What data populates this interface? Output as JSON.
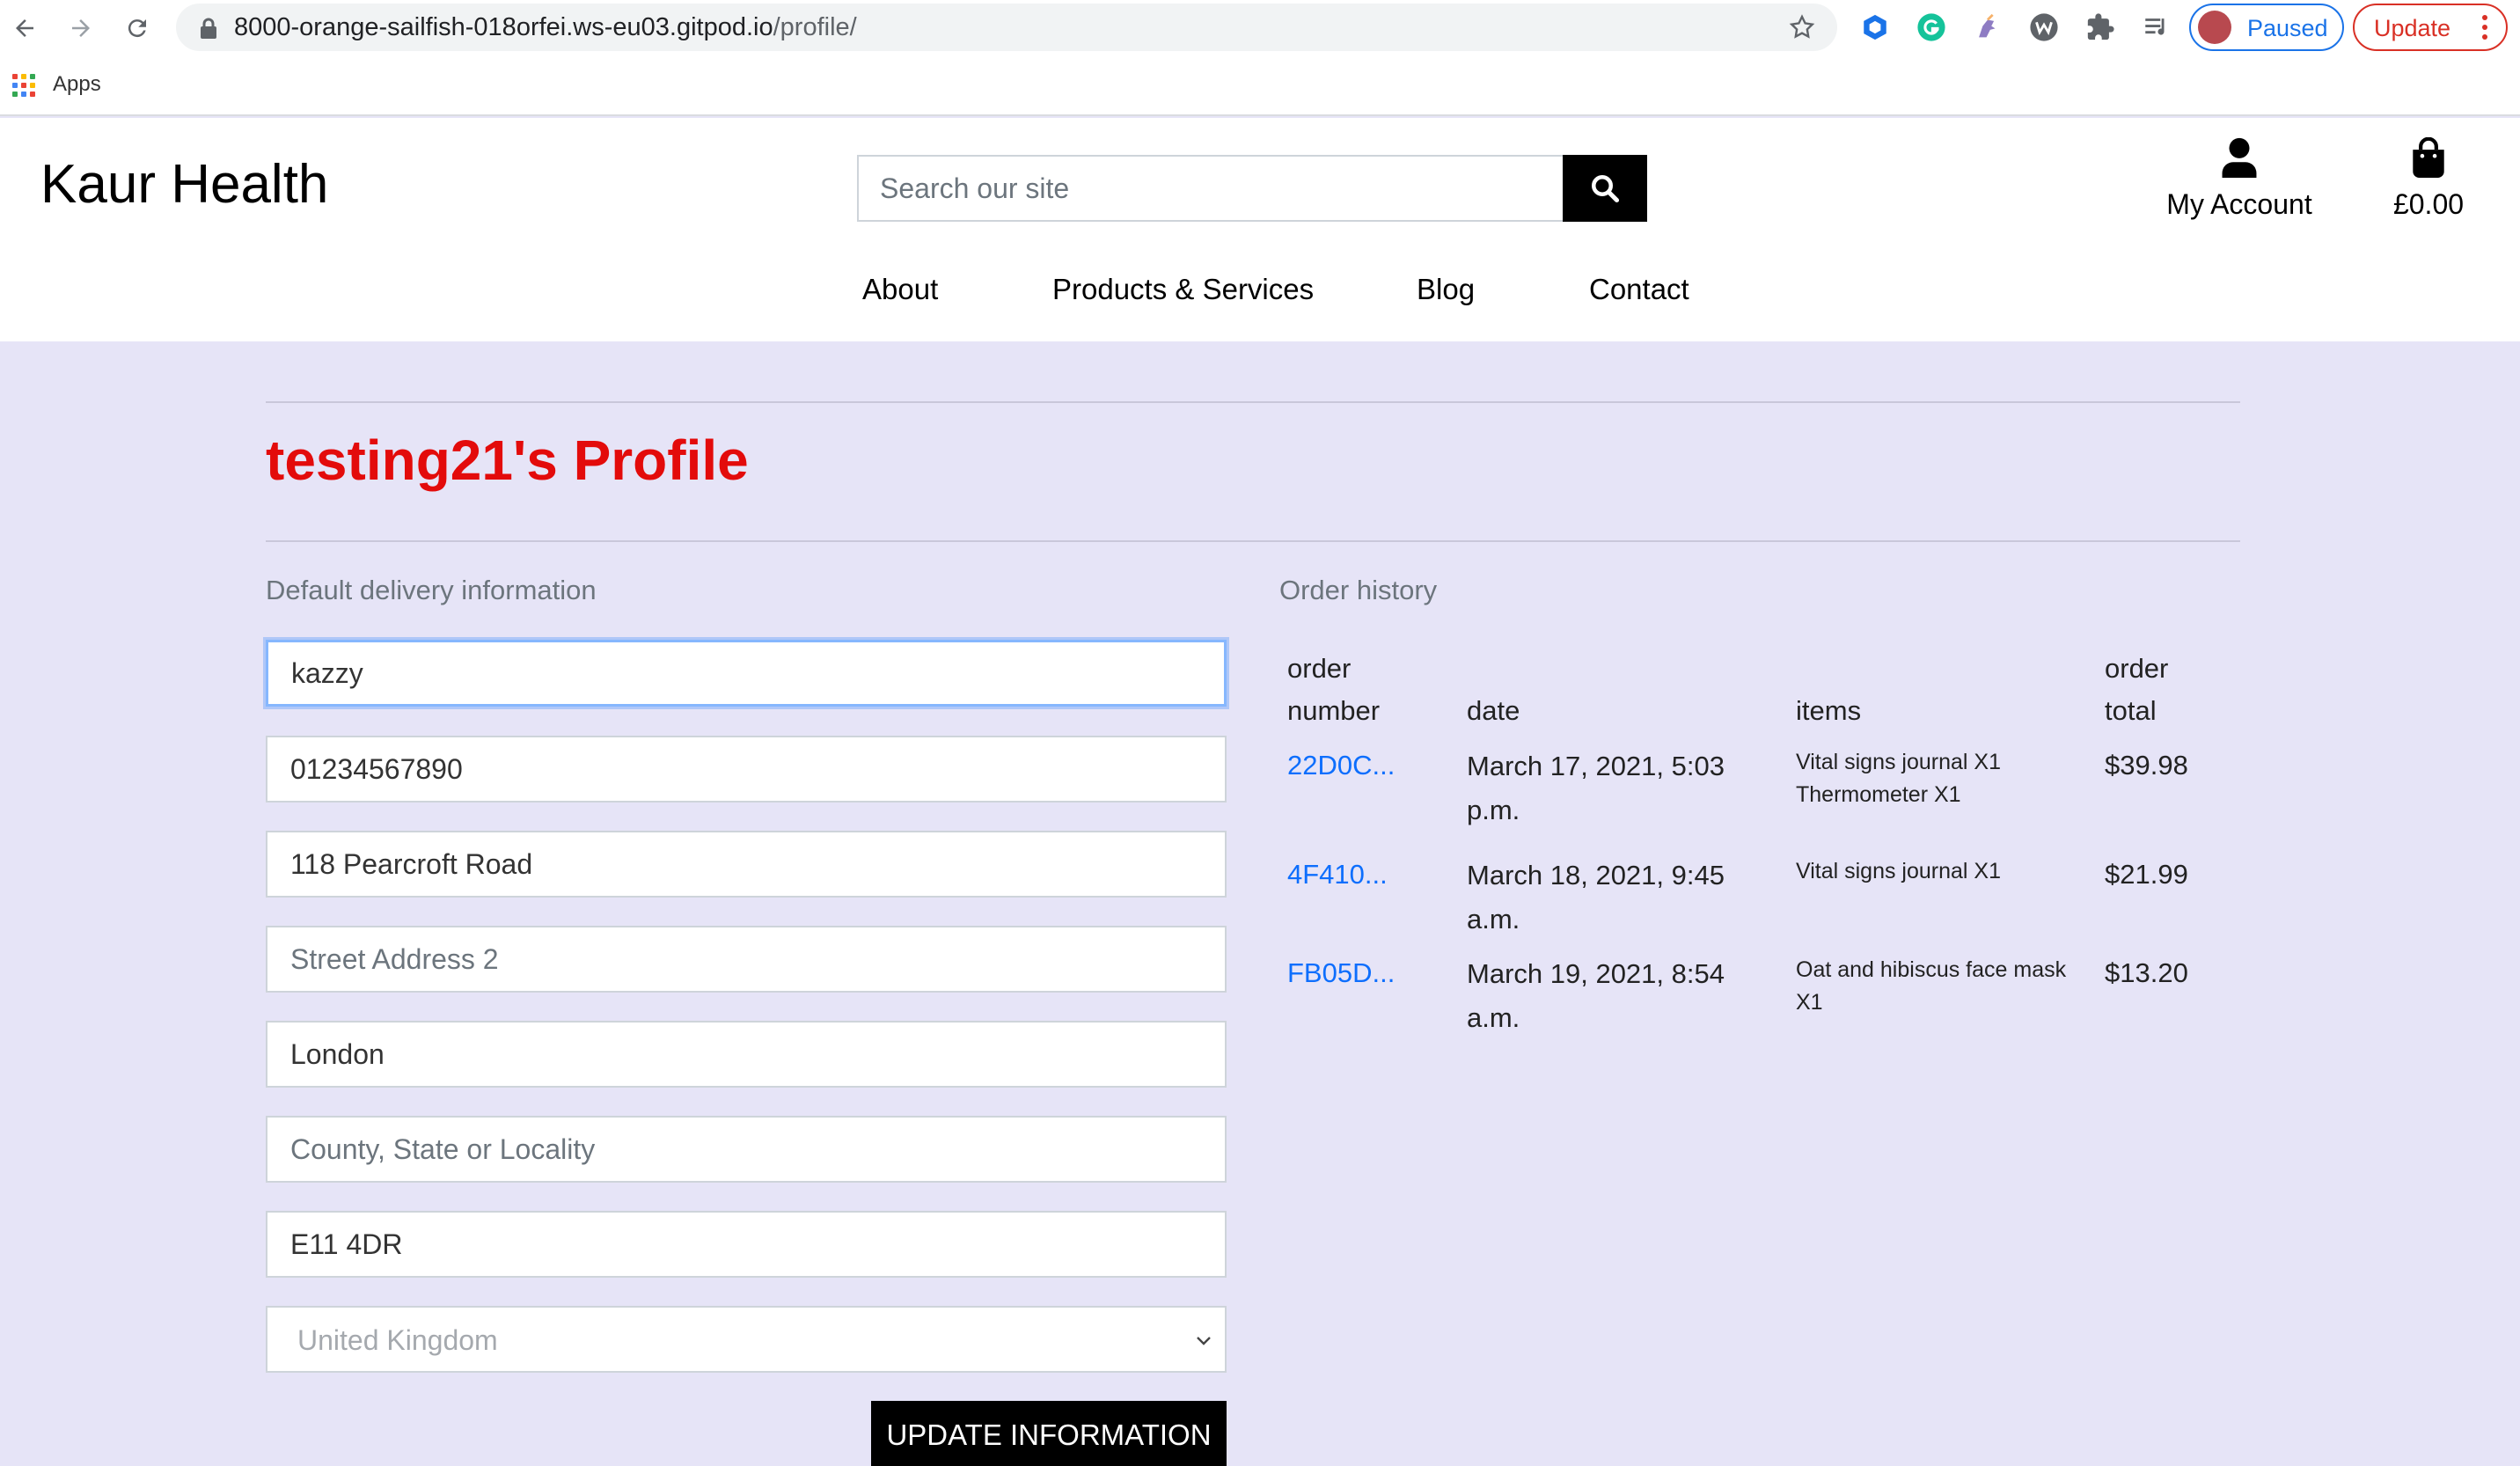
{
  "browser": {
    "url_host": "8000-orange-sailfish-018orfei.ws-eu03.gitpod.io",
    "url_path": "/profile/",
    "bookmarks": {
      "apps_label": "Apps"
    },
    "profile_status": "Paused",
    "update_label": "Update",
    "accent": "#1a73e8",
    "update_color": "#d93025"
  },
  "header": {
    "brand": "Kaur Health",
    "search_placeholder": "Search our site",
    "account_label": "My Account",
    "cart_total": "£0.00",
    "nav": [
      "About",
      "Products & Services",
      "Blog",
      "Contact"
    ]
  },
  "profile": {
    "title": "testing21's Profile",
    "title_color": "#e30b0b"
  },
  "delivery": {
    "heading": "Default delivery information",
    "fields": {
      "full_name": {
        "value": "kazzy",
        "placeholder": ""
      },
      "phone": {
        "value": "01234567890",
        "placeholder": ""
      },
      "street1": {
        "value": "118 Pearcroft Road",
        "placeholder": ""
      },
      "street2": {
        "value": "",
        "placeholder": "Street Address 2"
      },
      "town": {
        "value": "London",
        "placeholder": ""
      },
      "county": {
        "value": "",
        "placeholder": "County, State or Locality"
      },
      "postcode": {
        "value": "E11 4DR",
        "placeholder": ""
      },
      "country": {
        "value": "United Kingdom"
      }
    },
    "submit_label": "UPDATE INFORMATION"
  },
  "orders": {
    "heading": "Order history",
    "columns": {
      "number_l1": "order",
      "number_l2": "number",
      "date": "date",
      "items": "items",
      "total_l1": "order",
      "total_l2": "total"
    },
    "rows": [
      {
        "number": "22D0C...",
        "date_l1": "March 17, 2021, 5:03",
        "date_l2": "p.m.",
        "items_l1": "Vital signs journal X1",
        "items_l2": "Thermometer X1",
        "total": "$39.98"
      },
      {
        "number": "4F410...",
        "date_l1": "March 18, 2021, 9:45",
        "date_l2": "a.m.",
        "items_l1": "Vital signs journal X1",
        "items_l2": "",
        "total": "$21.99"
      },
      {
        "number": "FB05D...",
        "date_l1": "March 19, 2021, 8:54",
        "date_l2": "a.m.",
        "items_l1": "Oat and hibiscus face mask",
        "items_l2": "X1",
        "total": "$13.20"
      }
    ],
    "link_color": "#0d6efd"
  },
  "icons": [
    "back-icon",
    "forward-icon",
    "reload-icon",
    "lock-icon",
    "star-icon",
    "search-icon",
    "user-icon",
    "shopping-bag-icon",
    "chevron-down-icon"
  ]
}
